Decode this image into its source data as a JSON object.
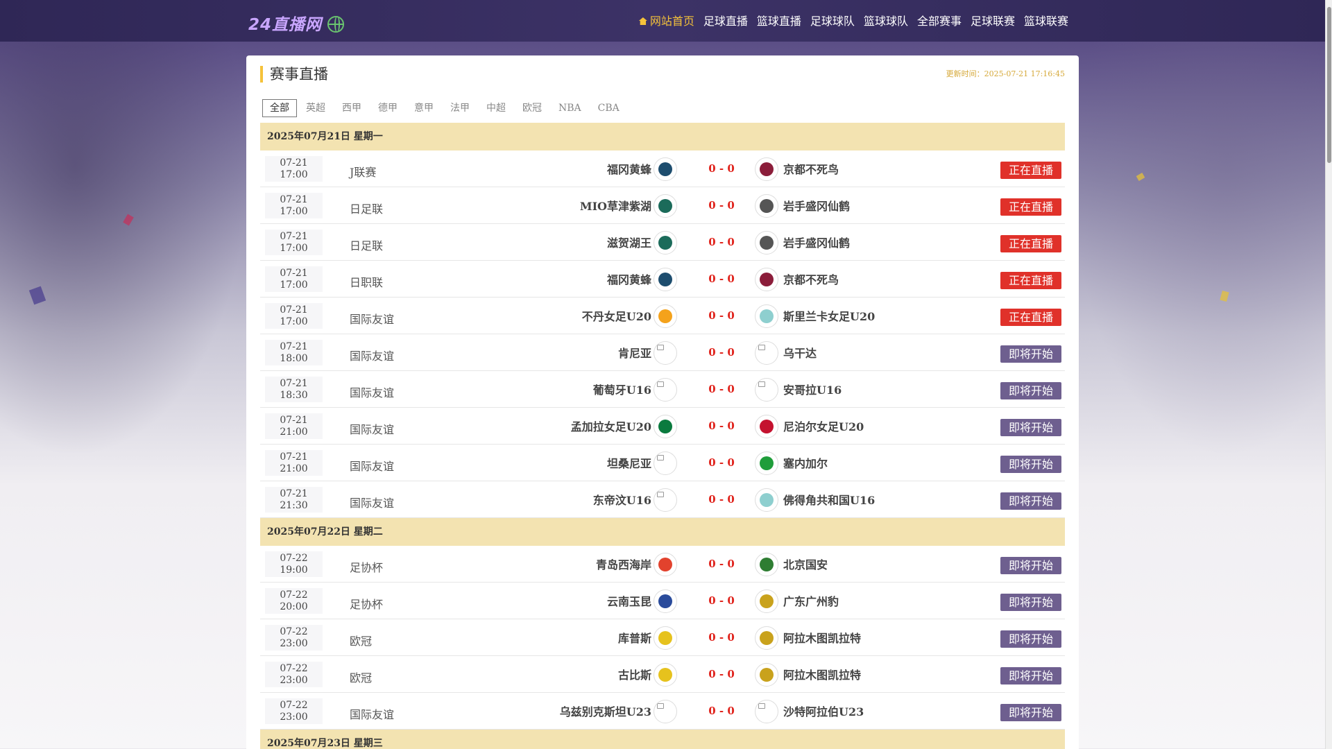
{
  "header": {
    "logo": "24直播网",
    "nav": [
      {
        "label": "网站首页",
        "active": true
      },
      {
        "label": "足球直播"
      },
      {
        "label": "篮球直播"
      },
      {
        "label": "足球球队"
      },
      {
        "label": "篮球球队"
      },
      {
        "label": "全部赛事"
      },
      {
        "label": "足球联赛"
      },
      {
        "label": "篮球联赛"
      }
    ]
  },
  "main": {
    "title": "赛事直播",
    "update_time": "更新时间：2025-07-21 17:16:45",
    "tabs": [
      "全部",
      "英超",
      "西甲",
      "德甲",
      "意甲",
      "法甲",
      "中超",
      "欧冠",
      "NBA",
      "CBA"
    ],
    "days": [
      {
        "date": "2025年07月21日 星期一",
        "matches": [
          {
            "date": "07-21",
            "time": "17:00",
            "league": "J联赛",
            "home": "福冈黄蜂",
            "score": "0 - 0",
            "away": "京都不死鸟",
            "status": "正在直播",
            "live": true,
            "home_color": "#1d4d6e",
            "away_color": "#8b1d3a"
          },
          {
            "date": "07-21",
            "time": "17:00",
            "league": "日足联",
            "home": "MIO草津紫湖",
            "score": "0 - 0",
            "away": "岩手盛冈仙鹤",
            "status": "正在直播",
            "live": true,
            "home_color": "#1b6b5a",
            "away_color": "#555555"
          },
          {
            "date": "07-21",
            "time": "17:00",
            "league": "日足联",
            "home": "滋贺湖王",
            "score": "0 - 0",
            "away": "岩手盛冈仙鹤",
            "status": "正在直播",
            "live": true,
            "home_color": "#1b6b5a",
            "away_color": "#555555"
          },
          {
            "date": "07-21",
            "time": "17:00",
            "league": "日职联",
            "home": "福冈黄蜂",
            "score": "0 - 0",
            "away": "京都不死鸟",
            "status": "正在直播",
            "live": true,
            "home_color": "#1d4d6e",
            "away_color": "#8b1d3a"
          },
          {
            "date": "07-21",
            "time": "17:00",
            "league": "国际友谊",
            "home": "不丹女足U20",
            "score": "0 - 0",
            "away": "斯里兰卡女足U20",
            "status": "正在直播",
            "live": true,
            "home_color": "#f4a21b",
            "away_color": "#8ecfcf"
          },
          {
            "date": "07-21",
            "time": "18:00",
            "league": "国际友谊",
            "home": "肯尼亚",
            "score": "0 - 0",
            "away": "乌干达",
            "status": "即将开始",
            "live": false
          },
          {
            "date": "07-21",
            "time": "18:30",
            "league": "国际友谊",
            "home": "葡萄牙U16",
            "score": "0 - 0",
            "away": "安哥拉U16",
            "status": "即将开始",
            "live": false
          },
          {
            "date": "07-21",
            "time": "21:00",
            "league": "国际友谊",
            "home": "孟加拉女足U20",
            "score": "0 - 0",
            "away": "尼泊尔女足U20",
            "status": "即将开始",
            "live": false,
            "home_color": "#0a7a3e",
            "away_color": "#c4122f"
          },
          {
            "date": "07-21",
            "time": "21:00",
            "league": "国际友谊",
            "home": "坦桑尼亚",
            "score": "0 - 0",
            "away": "塞内加尔",
            "status": "即将开始",
            "live": false,
            "away_color": "#1f9d3a"
          },
          {
            "date": "07-21",
            "time": "21:30",
            "league": "国际友谊",
            "home": "东帝汶U16",
            "score": "0 - 0",
            "away": "佛得角共和国U16",
            "status": "即将开始",
            "live": false,
            "away_color": "#8ecfcf"
          }
        ]
      },
      {
        "date": "2025年07月22日 星期二",
        "matches": [
          {
            "date": "07-22",
            "time": "19:00",
            "league": "足协杯",
            "home": "青岛西海岸",
            "score": "0 - 0",
            "away": "北京国安",
            "status": "即将开始",
            "live": false,
            "home_color": "#e2422d",
            "away_color": "#2e7d32"
          },
          {
            "date": "07-22",
            "time": "20:00",
            "league": "足协杯",
            "home": "云南玉昆",
            "score": "0 - 0",
            "away": "广东广州豹",
            "status": "即将开始",
            "live": false,
            "home_color": "#2a4b9b",
            "away_color": "#c9a21c"
          },
          {
            "date": "07-22",
            "time": "23:00",
            "league": "欧冠",
            "home": "库普斯",
            "score": "0 - 0",
            "away": "阿拉木图凯拉特",
            "status": "即将开始",
            "live": false,
            "home_color": "#e6c21d",
            "away_color": "#c9a21c"
          },
          {
            "date": "07-22",
            "time": "23:00",
            "league": "欧冠",
            "home": "古比斯",
            "score": "0 - 0",
            "away": "阿拉木图凯拉特",
            "status": "即将开始",
            "live": false,
            "home_color": "#e6c21d",
            "away_color": "#c9a21c"
          },
          {
            "date": "07-22",
            "time": "23:00",
            "league": "国际友谊",
            "home": "乌兹别克斯坦U23",
            "score": "0 - 0",
            "away": "沙特阿拉伯U23",
            "status": "即将开始",
            "live": false
          }
        ]
      },
      {
        "date": "2025年07月23日 星期三",
        "matches": []
      }
    ]
  }
}
